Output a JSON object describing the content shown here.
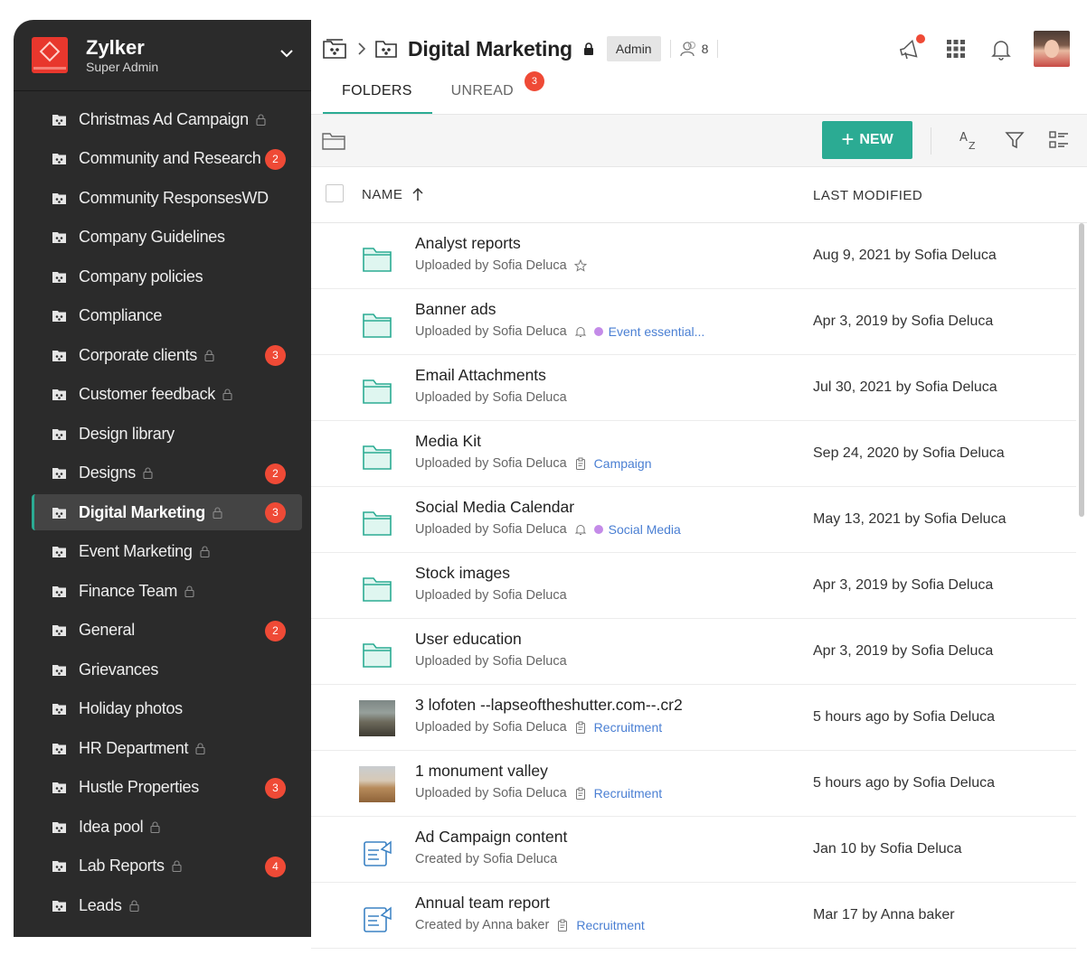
{
  "org": {
    "name": "Zylker",
    "role": "Super Admin"
  },
  "sidebar": {
    "items": [
      {
        "label": "Christmas Ad Campaign",
        "locked": true,
        "badge": ""
      },
      {
        "label": "Community and Research",
        "locked": false,
        "badge": "2"
      },
      {
        "label": "Community ResponsesWD",
        "locked": false,
        "badge": ""
      },
      {
        "label": "Company Guidelines",
        "locked": false,
        "badge": ""
      },
      {
        "label": "Company policies",
        "locked": false,
        "badge": ""
      },
      {
        "label": "Compliance",
        "locked": false,
        "badge": ""
      },
      {
        "label": "Corporate clients",
        "locked": true,
        "badge": "3"
      },
      {
        "label": "Customer feedback",
        "locked": true,
        "badge": ""
      },
      {
        "label": "Design library",
        "locked": false,
        "badge": ""
      },
      {
        "label": "Designs",
        "locked": true,
        "badge": "2"
      },
      {
        "label": "Digital Marketing",
        "locked": true,
        "badge": "3",
        "active": true
      },
      {
        "label": "Event Marketing",
        "locked": true,
        "badge": ""
      },
      {
        "label": "Finance Team",
        "locked": true,
        "badge": ""
      },
      {
        "label": "General",
        "locked": false,
        "badge": "2"
      },
      {
        "label": "Grievances",
        "locked": false,
        "badge": ""
      },
      {
        "label": "Holiday photos",
        "locked": false,
        "badge": ""
      },
      {
        "label": "HR Department",
        "locked": true,
        "badge": ""
      },
      {
        "label": "Hustle Properties",
        "locked": false,
        "badge": "3"
      },
      {
        "label": "Idea pool",
        "locked": true,
        "badge": ""
      },
      {
        "label": "Lab Reports",
        "locked": true,
        "badge": "4"
      },
      {
        "label": "Leads",
        "locked": true,
        "badge": ""
      }
    ]
  },
  "header": {
    "title": "Digital Marketing",
    "role_chip": "Admin",
    "member_count": "8",
    "tabs": [
      {
        "label": "FOLDERS",
        "badge": ""
      },
      {
        "label": "UNREAD",
        "badge": "3"
      }
    ]
  },
  "toolbar": {
    "new_label": "NEW"
  },
  "table": {
    "col_name": "NAME",
    "col_modified": "LAST MODIFIED",
    "rows": [
      {
        "name": "Analyst reports",
        "sub": "Uploaded by Sofia Deluca",
        "kind": "folder",
        "extra": "star",
        "tag": "",
        "tag_style": "",
        "modified": "Aug 9, 2021 by Sofia Deluca"
      },
      {
        "name": "Banner ads",
        "sub": "Uploaded by Sofia Deluca",
        "kind": "folder",
        "extra": "bell",
        "tag": "Event essential...",
        "tag_style": "dot",
        "modified": "Apr 3, 2019 by Sofia Deluca"
      },
      {
        "name": "Email Attachments",
        "sub": "Uploaded by Sofia Deluca",
        "kind": "folder",
        "extra": "",
        "tag": "",
        "tag_style": "",
        "modified": "Jul 30, 2021 by Sofia Deluca"
      },
      {
        "name": "Media Kit",
        "sub": "Uploaded by Sofia Deluca",
        "kind": "folder",
        "extra": "clip",
        "tag": "Campaign",
        "tag_style": "plain",
        "modified": "Sep 24, 2020 by Sofia Deluca"
      },
      {
        "name": "Social Media Calendar",
        "sub": "Uploaded by Sofia Deluca",
        "kind": "folder",
        "extra": "bell",
        "tag": "Social Media",
        "tag_style": "dot",
        "modified": "May 13, 2021 by Sofia Deluca"
      },
      {
        "name": "Stock images",
        "sub": "Uploaded by Sofia Deluca",
        "kind": "folder",
        "extra": "",
        "tag": "",
        "tag_style": "",
        "modified": "Apr 3, 2019 by Sofia Deluca"
      },
      {
        "name": "User education",
        "sub": "Uploaded by Sofia Deluca",
        "kind": "folder",
        "extra": "",
        "tag": "",
        "tag_style": "",
        "modified": "Apr 3, 2019 by Sofia Deluca"
      },
      {
        "name": "3 lofoten --lapseoftheshutter.com--.cr2",
        "sub": "Uploaded by Sofia Deluca",
        "kind": "thumb1",
        "extra": "clip",
        "tag": "Recruitment",
        "tag_style": "plain",
        "modified": "5 hours ago by Sofia Deluca"
      },
      {
        "name": "1 monument valley",
        "sub": "Uploaded by Sofia Deluca",
        "kind": "thumb2",
        "extra": "clip",
        "tag": "Recruitment",
        "tag_style": "plain",
        "modified": "5 hours ago by Sofia Deluca"
      },
      {
        "name": "Ad Campaign content",
        "sub": "Created by Sofia Deluca",
        "kind": "doc",
        "extra": "",
        "tag": "",
        "tag_style": "",
        "modified": "Jan 10 by Sofia Deluca"
      },
      {
        "name": "Annual team report",
        "sub": "Created by Anna baker",
        "kind": "doc",
        "extra": "clip",
        "tag": "Recruitment",
        "tag_style": "plain",
        "modified": "Mar 17 by Anna baker"
      }
    ]
  },
  "colors": {
    "accent": "#2bab93",
    "badge": "#ef4a36",
    "sidebar": "#2b2b2b",
    "tag": "#4a7fd3"
  }
}
